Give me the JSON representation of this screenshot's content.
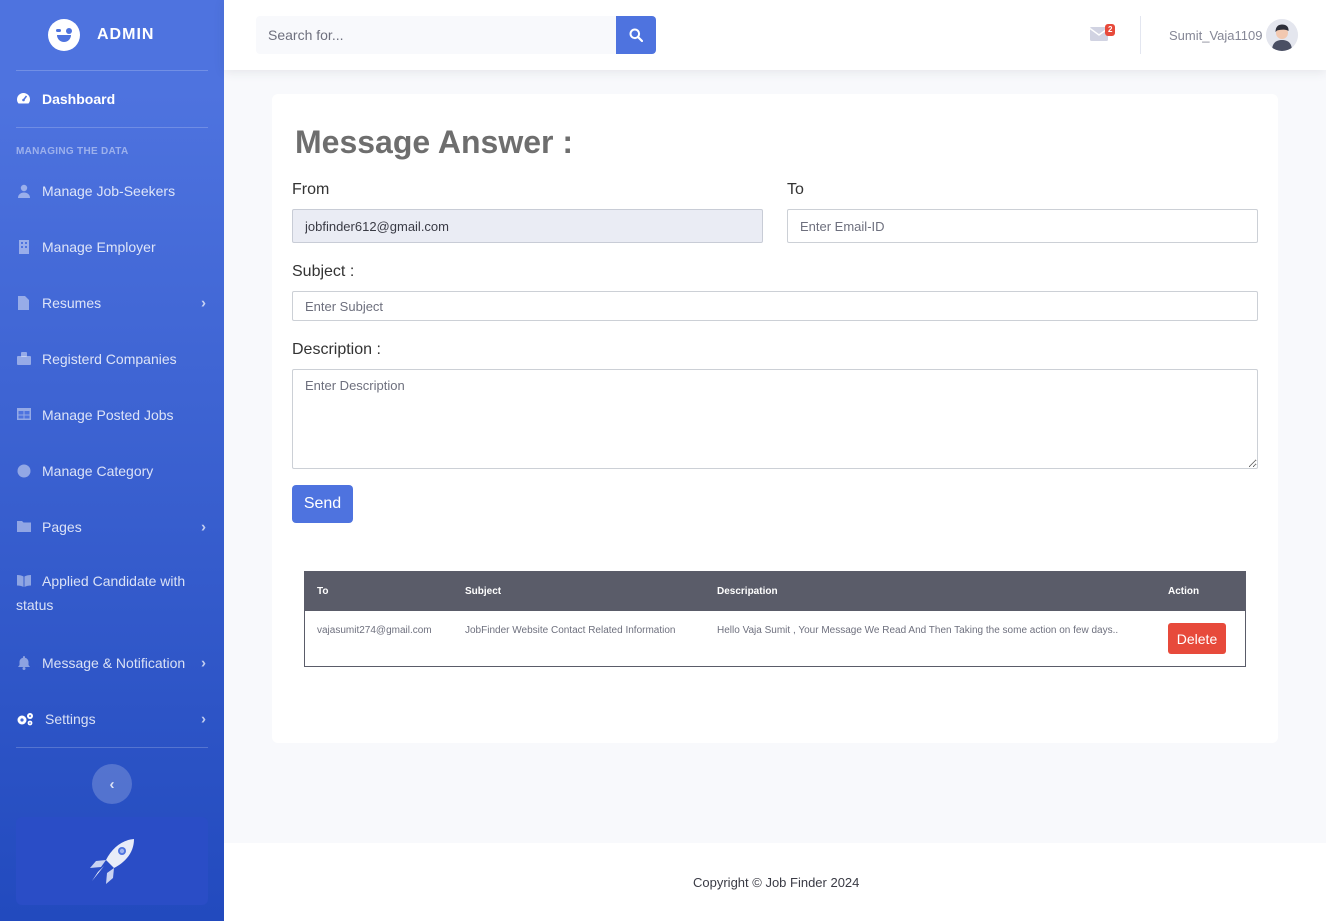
{
  "brand": {
    "title": "ADMIN"
  },
  "sidebar": {
    "dashboard": "Dashboard",
    "heading": "MANAGING THE DATA",
    "items": [
      {
        "label": "Manage Job-Seekers",
        "icon": "user-icon"
      },
      {
        "label": "Manage Employer",
        "icon": "building-icon"
      },
      {
        "label": "Resumes",
        "icon": "file-icon"
      },
      {
        "label": "Registerd Companies",
        "icon": "briefcase-icon"
      },
      {
        "label": "Manage Posted Jobs",
        "icon": "table-icon"
      },
      {
        "label": "Manage Category",
        "icon": "circle-icon"
      },
      {
        "label": "Pages",
        "icon": "folder-icon"
      },
      {
        "label": "Applied Candidate with status",
        "icon": "book-icon"
      },
      {
        "label": "Message & Notification",
        "icon": "bell-icon"
      },
      {
        "label": "Settings",
        "icon": "cogs-icon"
      }
    ]
  },
  "topbar": {
    "search_placeholder": "Search for...",
    "mail_count": "2",
    "username": "Sumit_Vaja1109"
  },
  "form": {
    "title": "Message Answer :",
    "from_label": "From",
    "from_value": "jobfinder612@gmail.com",
    "to_label": "To",
    "to_placeholder": "Enter Email-ID",
    "subject_label": "Subject :",
    "subject_placeholder": "Enter Subject",
    "description_label": "Description :",
    "description_placeholder": "Enter Description",
    "send_label": "Send"
  },
  "table": {
    "headers": [
      "To",
      "Subject",
      "Descripation",
      "Action"
    ],
    "rows": [
      {
        "to": "vajasumit274@gmail.com",
        "subject": "JobFinder Website Contact Related Information",
        "description": "Hello Vaja Sumit , Your Message We Read And Then Taking the some action on few days..",
        "action": "Delete"
      }
    ]
  },
  "footer": {
    "copyright": "Copyright © Job Finder 2024"
  },
  "colors": {
    "primary": "#4e73df",
    "danger": "#e74a3b",
    "table_header": "#5a5c69"
  }
}
